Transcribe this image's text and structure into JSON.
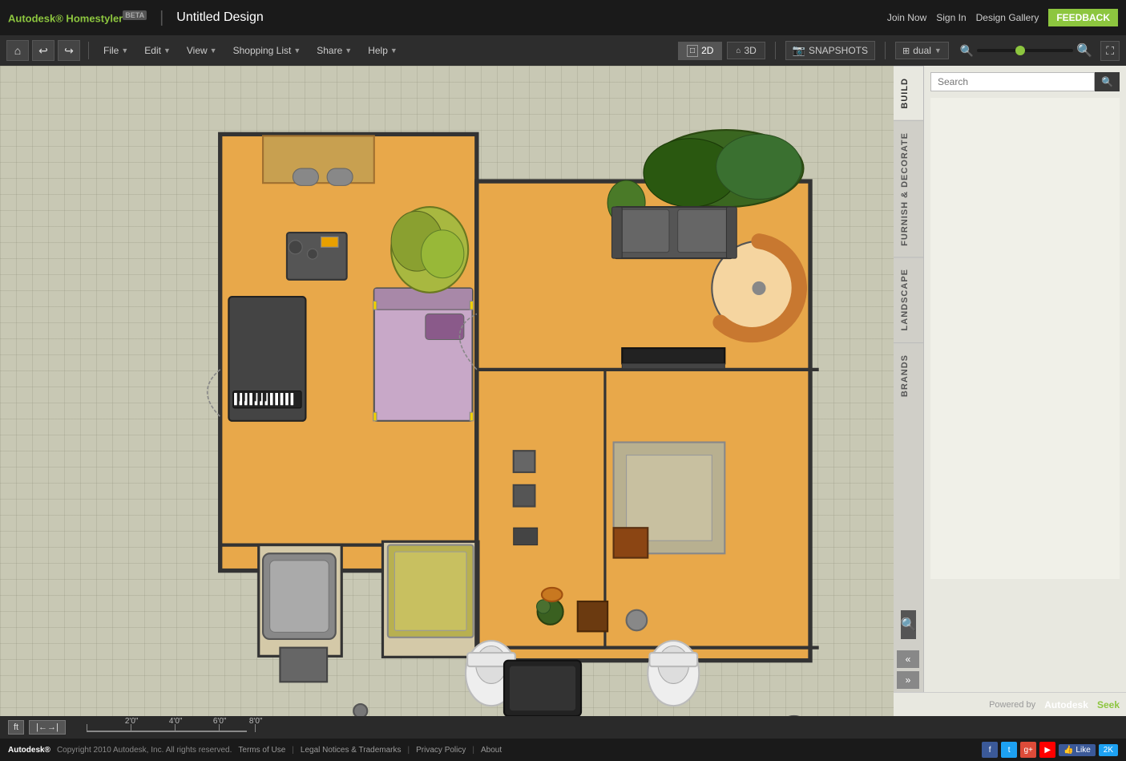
{
  "app": {
    "name": "Autodesk",
    "product": "Homestyler",
    "beta": "BETA",
    "title": "Untitled Design"
  },
  "topbar": {
    "join_now": "Join Now",
    "sign_in": "Sign In",
    "design_gallery": "Design Gallery",
    "feedback": "FEEDBACK"
  },
  "menubar": {
    "file": "File",
    "edit": "Edit",
    "view": "View",
    "shopping_list": "Shopping List",
    "share": "Share",
    "help": "Help",
    "mode_2d": "2D",
    "mode_3d": "3D",
    "snapshots": "SNAPSHOTS",
    "dual": "dual"
  },
  "panel_tabs": {
    "build": "BUILD",
    "furnish": "FURNISH & DECORATE",
    "landscape": "LANDSCAPE",
    "brands": "BRANDS"
  },
  "panel": {
    "search_placeholder": "Search"
  },
  "bottombar": {
    "unit": "ft",
    "ruler": "←→",
    "scale_marks": [
      "2'0\"",
      "4'0\"",
      "6'0\"",
      "8'0\""
    ],
    "powered_by": "Powered by",
    "autodesk": "Autodesk",
    "seek": "Seek"
  },
  "footer": {
    "copyright": "Copyright 2010 Autodesk, Inc. All rights reserved.",
    "terms": "Terms of Use",
    "legal": "Legal Notices & Trademarks",
    "privacy": "Privacy Policy",
    "about": "About",
    "like": "Like",
    "twok": "2K"
  }
}
